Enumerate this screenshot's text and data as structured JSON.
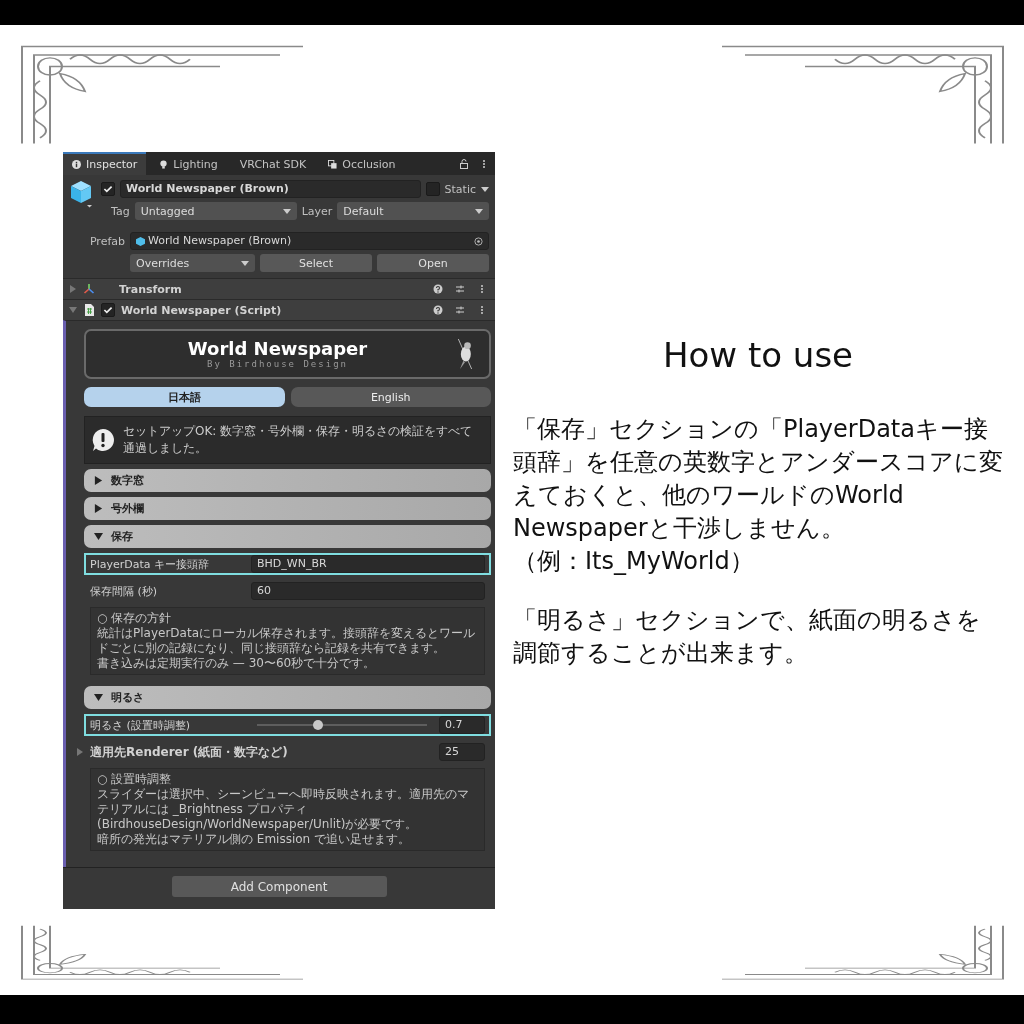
{
  "tabs": [
    {
      "label": "Inspector",
      "selected": true
    },
    {
      "label": "Lighting",
      "selected": false
    },
    {
      "label": "VRChat SDK",
      "selected": false
    },
    {
      "label": "Occlusion",
      "selected": false
    }
  ],
  "object": {
    "enabled": true,
    "name": "World Newspaper (Brown)",
    "static_label": "Static",
    "static": false,
    "tag_label": "Tag",
    "tag": "Untagged",
    "layer_label": "Layer",
    "layer": "Default"
  },
  "prefab": {
    "label": "Prefab",
    "name": "World Newspaper (Brown)",
    "overrides": "Overrides",
    "buttons": [
      "Select",
      "Open"
    ]
  },
  "components": [
    {
      "name": "Transform",
      "expanded": false
    },
    {
      "name": "World Newspaper (Script)",
      "expanded": true,
      "enabled": true
    }
  ],
  "banner": {
    "title": "World Newspaper",
    "subtitle": "By Birdhouse Design"
  },
  "language_tabs": [
    {
      "label": "日本語",
      "selected": true
    },
    {
      "label": "English",
      "selected": false
    }
  ],
  "status_message": "セットアップOK: 数字窓・号外欄・保存・明るさの検証をすべて通過しました。",
  "sections": [
    {
      "title": "数字窓",
      "expanded": false
    },
    {
      "title": "号外欄",
      "expanded": false
    },
    {
      "title": "保存",
      "expanded": true,
      "fields": [
        {
          "kind": "text",
          "label": "PlayerData キー接頭辞",
          "value": "BHD_WN_BR",
          "highlighted": true
        },
        {
          "kind": "text",
          "label": "保存間隔 (秒)",
          "value": "60",
          "highlighted": false
        }
      ],
      "note": {
        "title": "○ 保存の方針",
        "lines": [
          "統計はPlayerDataにローカル保存されます。接頭辞を変えるとワールドごとに別の記録になり、同じ接頭辞なら記録を共有できます。",
          "書き込みは定期実行のみ — 30〜60秒で十分です。"
        ]
      }
    },
    {
      "title": "明るさ",
      "expanded": true,
      "fields": [
        {
          "kind": "slider",
          "label": "明るさ (設置時調整)",
          "level": 0.36,
          "value": "0.7",
          "highlighted": true
        },
        {
          "kind": "foldout",
          "label": "適用先Renderer (紙面・数字など)",
          "value": "25",
          "expanded": false,
          "highlighted": false
        }
      ],
      "note": {
        "title": "○ 設置時調整",
        "lines": [
          "スライダーは選択中、シーンビューへ即時反映されます。適用先のマテリアルには _Brightness プロパティ(BirdhouseDesign/WorldNewspaper/Unlit)が必要です。",
          "暗所の発光はマテリアル側の Emission で追い足せます。"
        ]
      }
    }
  ],
  "add_component": "Add Component",
  "guide": {
    "title": "How to use",
    "blocks": [
      {
        "lines": [
          "「保存」セクションの「PlayerDataキー接頭辞」を任意の英数字とアンダースコアに変えておくと、他のワールドのWorld Newspaperと干渉しません。",
          "（例：Its_MyWorld）"
        ]
      },
      {
        "lines": [
          "「明るさ」セクションで、紙面の明るさを調節することが出来ます。"
        ]
      }
    ]
  }
}
